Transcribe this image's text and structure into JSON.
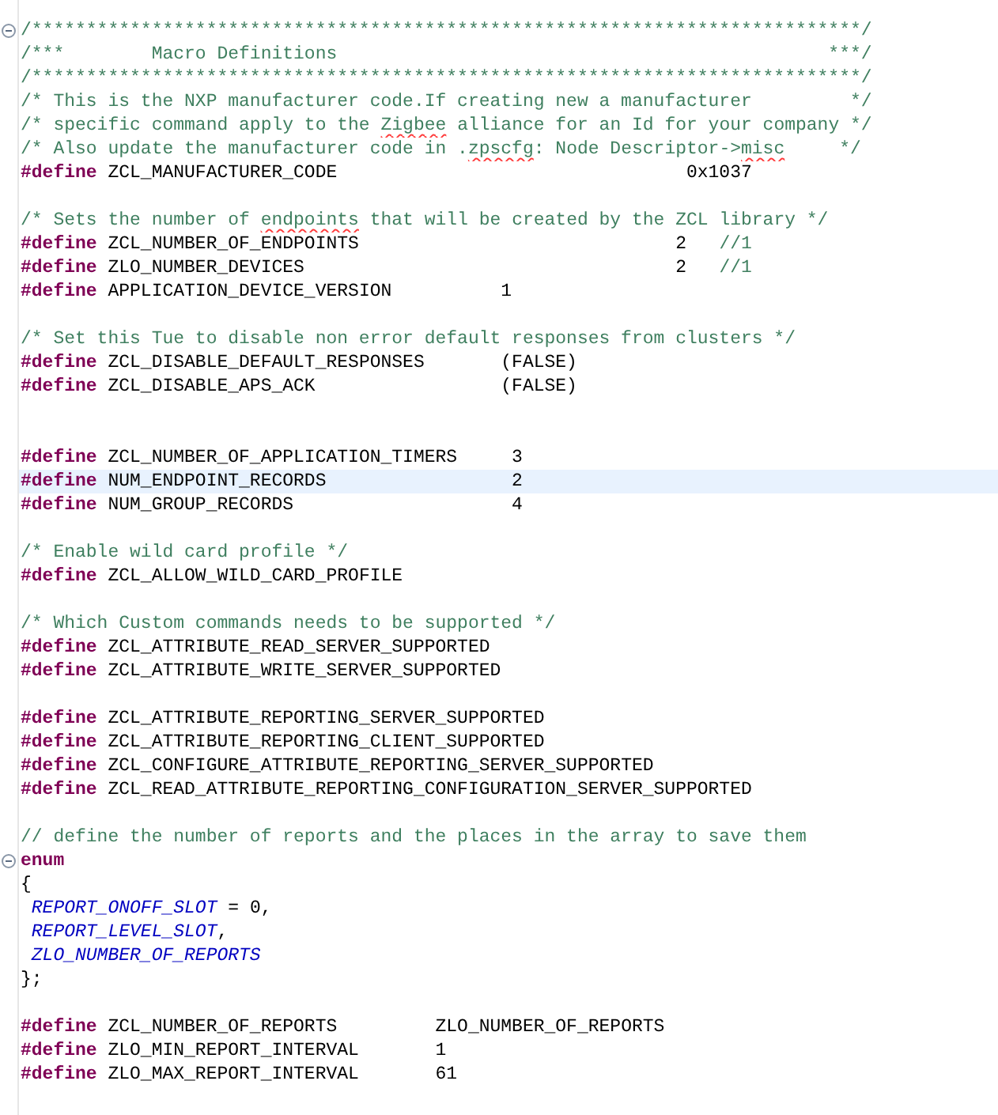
{
  "editor": {
    "lines": [
      {
        "kind": "code",
        "foldable": true,
        "current": false,
        "tokens": [
          {
            "kind": "comment",
            "text": "/****************************************************************************/"
          }
        ]
      },
      {
        "kind": "code",
        "foldable": false,
        "current": false,
        "tokens": [
          {
            "kind": "comment",
            "text": "/***        Macro Definitions                                             ***/"
          }
        ]
      },
      {
        "kind": "code",
        "foldable": false,
        "current": false,
        "tokens": [
          {
            "kind": "comment",
            "text": "/****************************************************************************/"
          }
        ]
      },
      {
        "kind": "code",
        "foldable": false,
        "current": false,
        "tokens": [
          {
            "kind": "comment",
            "text": "/* This is the NXP manufacturer code.If creating new a manufacturer         */"
          }
        ]
      },
      {
        "kind": "code",
        "foldable": false,
        "current": false,
        "tokens": [
          {
            "kind": "comment",
            "text": "/* specific command apply to the "
          },
          {
            "kind": "misspelled",
            "text": "Zigbee"
          },
          {
            "kind": "comment",
            "text": " alliance for an Id for your company */"
          }
        ]
      },
      {
        "kind": "code",
        "foldable": false,
        "current": false,
        "tokens": [
          {
            "kind": "comment",
            "text": "/* Also update the manufacturer code in ."
          },
          {
            "kind": "misspelled",
            "text": "zpscfg"
          },
          {
            "kind": "comment",
            "text": ": Node Descriptor->"
          },
          {
            "kind": "misspelled",
            "text": "misc"
          },
          {
            "kind": "comment",
            "text": "     */"
          }
        ]
      },
      {
        "kind": "code",
        "foldable": false,
        "current": false,
        "tokens": [
          {
            "kind": "directive",
            "text": "#define"
          },
          {
            "kind": "text",
            "text": " ZCL_MANUFACTURER_CODE                                0x1037"
          }
        ]
      },
      {
        "kind": "blank"
      },
      {
        "kind": "code",
        "foldable": false,
        "current": false,
        "tokens": [
          {
            "kind": "comment",
            "text": "/* Sets the number of "
          },
          {
            "kind": "misspelled",
            "text": "endpoints"
          },
          {
            "kind": "comment",
            "text": " that will be created by the ZCL library */"
          }
        ]
      },
      {
        "kind": "code",
        "foldable": false,
        "current": false,
        "tokens": [
          {
            "kind": "directive",
            "text": "#define"
          },
          {
            "kind": "text",
            "text": " ZCL_NUMBER_OF_ENDPOINTS                             2   "
          },
          {
            "kind": "comment",
            "text": "//1"
          }
        ]
      },
      {
        "kind": "code",
        "foldable": false,
        "current": false,
        "tokens": [
          {
            "kind": "directive",
            "text": "#define"
          },
          {
            "kind": "text",
            "text": " ZLO_NUMBER_DEVICES                                  2   "
          },
          {
            "kind": "comment",
            "text": "//1"
          }
        ]
      },
      {
        "kind": "code",
        "foldable": false,
        "current": false,
        "tokens": [
          {
            "kind": "directive",
            "text": "#define"
          },
          {
            "kind": "text",
            "text": " APPLICATION_DEVICE_VERSION          1"
          }
        ]
      },
      {
        "kind": "blank"
      },
      {
        "kind": "code",
        "foldable": false,
        "current": false,
        "tokens": [
          {
            "kind": "comment",
            "text": "/* Set this Tue to disable non error default responses from clusters */"
          }
        ]
      },
      {
        "kind": "code",
        "foldable": false,
        "current": false,
        "tokens": [
          {
            "kind": "directive",
            "text": "#define"
          },
          {
            "kind": "text",
            "text": " ZCL_DISABLE_DEFAULT_RESPONSES       (FALSE)"
          }
        ]
      },
      {
        "kind": "code",
        "foldable": false,
        "current": false,
        "tokens": [
          {
            "kind": "directive",
            "text": "#define"
          },
          {
            "kind": "text",
            "text": " ZCL_DISABLE_APS_ACK                 (FALSE)"
          }
        ]
      },
      {
        "kind": "blank"
      },
      {
        "kind": "blank"
      },
      {
        "kind": "code",
        "foldable": false,
        "current": false,
        "tokens": [
          {
            "kind": "directive",
            "text": "#define"
          },
          {
            "kind": "text",
            "text": " ZCL_NUMBER_OF_APPLICATION_TIMERS     3"
          }
        ]
      },
      {
        "kind": "code",
        "foldable": false,
        "current": true,
        "tokens": [
          {
            "kind": "directive",
            "text": "#define"
          },
          {
            "kind": "text",
            "text": " NUM_ENDPOINT_RECORDS                 2"
          }
        ]
      },
      {
        "kind": "code",
        "foldable": false,
        "current": false,
        "tokens": [
          {
            "kind": "directive",
            "text": "#define"
          },
          {
            "kind": "text",
            "text": " NUM_GROUP_RECORDS                    4"
          }
        ]
      },
      {
        "kind": "blank"
      },
      {
        "kind": "code",
        "foldable": false,
        "current": false,
        "tokens": [
          {
            "kind": "comment",
            "text": "/* Enable wild card profile */"
          }
        ]
      },
      {
        "kind": "code",
        "foldable": false,
        "current": false,
        "tokens": [
          {
            "kind": "directive",
            "text": "#define"
          },
          {
            "kind": "text",
            "text": " ZCL_ALLOW_WILD_CARD_PROFILE"
          }
        ]
      },
      {
        "kind": "blank"
      },
      {
        "kind": "code",
        "foldable": false,
        "current": false,
        "tokens": [
          {
            "kind": "comment",
            "text": "/* Which Custom commands needs to be supported */"
          }
        ]
      },
      {
        "kind": "code",
        "foldable": false,
        "current": false,
        "tokens": [
          {
            "kind": "directive",
            "text": "#define"
          },
          {
            "kind": "text",
            "text": " ZCL_ATTRIBUTE_READ_SERVER_SUPPORTED"
          }
        ]
      },
      {
        "kind": "code",
        "foldable": false,
        "current": false,
        "tokens": [
          {
            "kind": "directive",
            "text": "#define"
          },
          {
            "kind": "text",
            "text": " ZCL_ATTRIBUTE_WRITE_SERVER_SUPPORTED"
          }
        ]
      },
      {
        "kind": "blank"
      },
      {
        "kind": "code",
        "foldable": false,
        "current": false,
        "tokens": [
          {
            "kind": "directive",
            "text": "#define"
          },
          {
            "kind": "text",
            "text": " ZCL_ATTRIBUTE_REPORTING_SERVER_SUPPORTED"
          }
        ]
      },
      {
        "kind": "code",
        "foldable": false,
        "current": false,
        "tokens": [
          {
            "kind": "directive",
            "text": "#define"
          },
          {
            "kind": "text",
            "text": " ZCL_ATTRIBUTE_REPORTING_CLIENT_SUPPORTED"
          }
        ]
      },
      {
        "kind": "code",
        "foldable": false,
        "current": false,
        "tokens": [
          {
            "kind": "directive",
            "text": "#define"
          },
          {
            "kind": "text",
            "text": " ZCL_CONFIGURE_ATTRIBUTE_REPORTING_SERVER_SUPPORTED"
          }
        ]
      },
      {
        "kind": "code",
        "foldable": false,
        "current": false,
        "tokens": [
          {
            "kind": "directive",
            "text": "#define"
          },
          {
            "kind": "text",
            "text": " ZCL_READ_ATTRIBUTE_REPORTING_CONFIGURATION_SERVER_SUPPORTED"
          }
        ]
      },
      {
        "kind": "blank"
      },
      {
        "kind": "code",
        "foldable": false,
        "current": false,
        "tokens": [
          {
            "kind": "comment",
            "text": "// define the number of reports and the places in the array to save them"
          }
        ]
      },
      {
        "kind": "code",
        "foldable": true,
        "current": false,
        "tokens": [
          {
            "kind": "directive",
            "text": "enum"
          }
        ]
      },
      {
        "kind": "code",
        "foldable": false,
        "current": false,
        "tokens": [
          {
            "kind": "text",
            "text": "{"
          }
        ]
      },
      {
        "kind": "code",
        "foldable": false,
        "current": false,
        "tokens": [
          {
            "kind": "constant",
            "text": " REPORT_ONOFF_SLOT"
          },
          {
            "kind": "text",
            "text": " = 0,"
          }
        ]
      },
      {
        "kind": "code",
        "foldable": false,
        "current": false,
        "tokens": [
          {
            "kind": "constant",
            "text": " REPORT_LEVEL_SLOT"
          },
          {
            "kind": "text",
            "text": ","
          }
        ]
      },
      {
        "kind": "code",
        "foldable": false,
        "current": false,
        "tokens": [
          {
            "kind": "constant",
            "text": " ZLO_NUMBER_OF_REPORTS"
          }
        ]
      },
      {
        "kind": "code",
        "foldable": false,
        "current": false,
        "tokens": [
          {
            "kind": "text",
            "text": "};"
          }
        ]
      },
      {
        "kind": "blank"
      },
      {
        "kind": "code",
        "foldable": false,
        "current": false,
        "tokens": [
          {
            "kind": "directive",
            "text": "#define"
          },
          {
            "kind": "text",
            "text": " ZCL_NUMBER_OF_REPORTS         ZLO_NUMBER_OF_REPORTS"
          }
        ]
      },
      {
        "kind": "code",
        "foldable": false,
        "current": false,
        "tokens": [
          {
            "kind": "directive",
            "text": "#define"
          },
          {
            "kind": "text",
            "text": " ZLO_MIN_REPORT_INTERVAL       1"
          }
        ]
      },
      {
        "kind": "code",
        "foldable": false,
        "current": false,
        "tokens": [
          {
            "kind": "directive",
            "text": "#define"
          },
          {
            "kind": "text",
            "text": " ZLO_MAX_REPORT_INTERVAL       61"
          }
        ]
      }
    ]
  }
}
